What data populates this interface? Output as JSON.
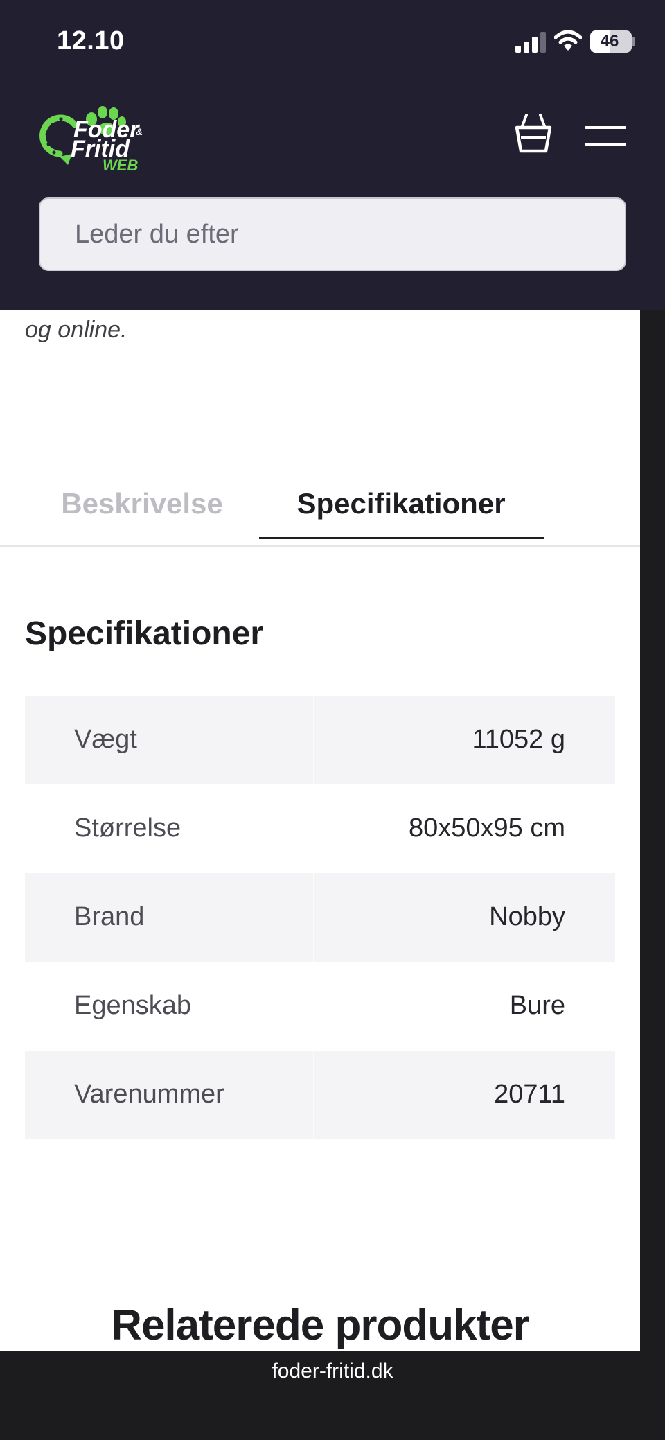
{
  "status_bar": {
    "time": "12.10",
    "battery": "46",
    "icons": [
      "signal-icon",
      "wifi-icon",
      "battery-icon"
    ]
  },
  "header": {
    "logo": {
      "line1": "Foder",
      "line2": "Fritid",
      "amp": "&",
      "line3": "WEB",
      "brand_green": "#6bd650"
    },
    "icons": [
      "basket-icon",
      "menu-icon"
    ],
    "search_placeholder": "Leder du efter"
  },
  "content": {
    "intro_tail": "og online.",
    "tabs": [
      {
        "label": "Beskrivelse",
        "active": false
      },
      {
        "label": "Specifikationer",
        "active": true
      }
    ],
    "spec_title": "Specifikationer",
    "specs": [
      {
        "key": "Vægt",
        "value": "11052 g"
      },
      {
        "key": "Størrelse",
        "value": "80x50x95 cm"
      },
      {
        "key": "Brand",
        "value": "Nobby"
      },
      {
        "key": "Egenskab",
        "value": "Bure"
      },
      {
        "key": "Varenummer",
        "value": "20711"
      }
    ],
    "related_title": "Relaterede produkter"
  },
  "browser": {
    "url": "foder-fritid.dk"
  },
  "colors": {
    "header_bg": "#221f31",
    "row_shade": "#f4f4f6",
    "text_dark": "#1e1d22",
    "tab_inactive": "#bdbcc2"
  }
}
